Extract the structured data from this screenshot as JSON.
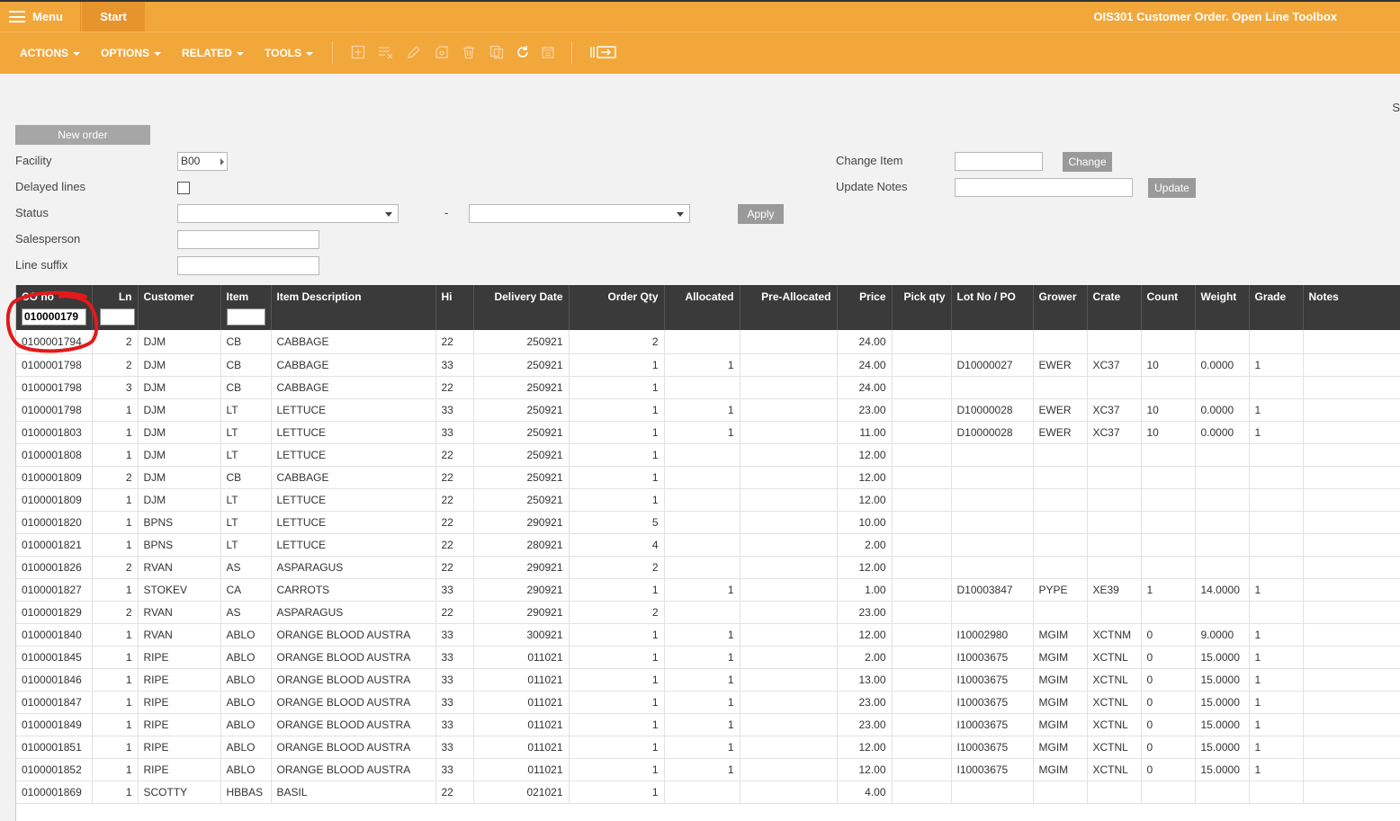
{
  "topbar": {
    "menu_label": "Menu",
    "start_tab": "Start",
    "title": "OIS301 Customer Order. Open Line Toolbox"
  },
  "toolbar": {
    "menus": [
      "ACTIONS",
      "OPTIONS",
      "RELATED",
      "TOOLS"
    ],
    "icons": [
      "add-icon",
      "copy-lines-icon",
      "edit-icon",
      "save-icon",
      "delete-icon",
      "duplicate-icon",
      "refresh-icon",
      "calendar-icon",
      "export-icon"
    ]
  },
  "form": {
    "new_order": "New order",
    "facility_label": "Facility",
    "facility_value": "B00",
    "delayed_label": "Delayed lines",
    "status_label": "Status",
    "status_dash": "-",
    "apply": "Apply",
    "salesperson_label": "Salesperson",
    "line_suffix_label": "Line suffix",
    "change_item_label": "Change Item",
    "change_btn": "Change",
    "update_notes_label": "Update Notes",
    "update_btn": "Update",
    "edge_text": "S"
  },
  "grid": {
    "columns": [
      "CO no",
      "Ln",
      "Customer",
      "Item",
      "Item Description",
      "Hi",
      "Delivery Date",
      "Order Qty",
      "Allocated",
      "Pre-Allocated",
      "Price",
      "Pick qty",
      "Lot No / PO",
      "Grower",
      "Crate",
      "Count",
      "Weight",
      "Grade",
      "Notes"
    ],
    "filter_co": "010000179",
    "rows": [
      [
        "0100001794",
        "2",
        "DJM",
        "CB",
        "CABBAGE",
        "22",
        "250921",
        "2",
        "",
        "",
        "24.00",
        "",
        "",
        "",
        "",
        "",
        "",
        "",
        ""
      ],
      [
        "0100001798",
        "2",
        "DJM",
        "CB",
        "CABBAGE",
        "33",
        "250921",
        "1",
        "1",
        "",
        "24.00",
        "",
        "D10000027",
        "EWER",
        "XC37",
        "10",
        "0.0000",
        "1",
        ""
      ],
      [
        "0100001798",
        "3",
        "DJM",
        "CB",
        "CABBAGE",
        "22",
        "250921",
        "1",
        "",
        "",
        "24.00",
        "",
        "",
        "",
        "",
        "",
        "",
        "",
        ""
      ],
      [
        "0100001798",
        "1",
        "DJM",
        "LT",
        "LETTUCE",
        "33",
        "250921",
        "1",
        "1",
        "",
        "23.00",
        "",
        "D10000028",
        "EWER",
        "XC37",
        "10",
        "0.0000",
        "1",
        ""
      ],
      [
        "0100001803",
        "1",
        "DJM",
        "LT",
        "LETTUCE",
        "33",
        "250921",
        "1",
        "1",
        "",
        "11.00",
        "",
        "D10000028",
        "EWER",
        "XC37",
        "10",
        "0.0000",
        "1",
        ""
      ],
      [
        "0100001808",
        "1",
        "DJM",
        "LT",
        "LETTUCE",
        "22",
        "250921",
        "1",
        "",
        "",
        "12.00",
        "",
        "",
        "",
        "",
        "",
        "",
        "",
        ""
      ],
      [
        "0100001809",
        "2",
        "DJM",
        "CB",
        "CABBAGE",
        "22",
        "250921",
        "1",
        "",
        "",
        "12.00",
        "",
        "",
        "",
        "",
        "",
        "",
        "",
        ""
      ],
      [
        "0100001809",
        "1",
        "DJM",
        "LT",
        "LETTUCE",
        "22",
        "250921",
        "1",
        "",
        "",
        "12.00",
        "",
        "",
        "",
        "",
        "",
        "",
        "",
        ""
      ],
      [
        "0100001820",
        "1",
        "BPNS",
        "LT",
        "LETTUCE",
        "22",
        "290921",
        "5",
        "",
        "",
        "10.00",
        "",
        "",
        "",
        "",
        "",
        "",
        "",
        ""
      ],
      [
        "0100001821",
        "1",
        "BPNS",
        "LT",
        "LETTUCE",
        "22",
        "280921",
        "4",
        "",
        "",
        "2.00",
        "",
        "",
        "",
        "",
        "",
        "",
        "",
        ""
      ],
      [
        "0100001826",
        "2",
        "RVAN",
        "AS",
        "ASPARAGUS",
        "22",
        "290921",
        "2",
        "",
        "",
        "12.00",
        "",
        "",
        "",
        "",
        "",
        "",
        "",
        ""
      ],
      [
        "0100001827",
        "1",
        "STOKEV",
        "CA",
        "CARROTS",
        "33",
        "290921",
        "1",
        "1",
        "",
        "1.00",
        "",
        "D10003847",
        "PYPE",
        "XE39",
        "1",
        "14.0000",
        "1",
        ""
      ],
      [
        "0100001829",
        "2",
        "RVAN",
        "AS",
        "ASPARAGUS",
        "22",
        "290921",
        "2",
        "",
        "",
        "23.00",
        "",
        "",
        "",
        "",
        "",
        "",
        "",
        ""
      ],
      [
        "0100001840",
        "1",
        "RVAN",
        "ABLO",
        "ORANGE BLOOD AUSTRA",
        "33",
        "300921",
        "1",
        "1",
        "",
        "12.00",
        "",
        "I10002980",
        "MGIM",
        "XCTNM",
        "0",
        "9.0000",
        "1",
        ""
      ],
      [
        "0100001845",
        "1",
        "RIPE",
        "ABLO",
        "ORANGE BLOOD AUSTRA",
        "33",
        "011021",
        "1",
        "1",
        "",
        "2.00",
        "",
        "I10003675",
        "MGIM",
        "XCTNL",
        "0",
        "15.0000",
        "1",
        ""
      ],
      [
        "0100001846",
        "1",
        "RIPE",
        "ABLO",
        "ORANGE BLOOD AUSTRA",
        "33",
        "011021",
        "1",
        "1",
        "",
        "13.00",
        "",
        "I10003675",
        "MGIM",
        "XCTNL",
        "0",
        "15.0000",
        "1",
        ""
      ],
      [
        "0100001847",
        "1",
        "RIPE",
        "ABLO",
        "ORANGE BLOOD AUSTRA",
        "33",
        "011021",
        "1",
        "1",
        "",
        "23.00",
        "",
        "I10003675",
        "MGIM",
        "XCTNL",
        "0",
        "15.0000",
        "1",
        ""
      ],
      [
        "0100001849",
        "1",
        "RIPE",
        "ABLO",
        "ORANGE BLOOD AUSTRA",
        "33",
        "011021",
        "1",
        "1",
        "",
        "23.00",
        "",
        "I10003675",
        "MGIM",
        "XCTNL",
        "0",
        "15.0000",
        "1",
        ""
      ],
      [
        "0100001851",
        "1",
        "RIPE",
        "ABLO",
        "ORANGE BLOOD AUSTRA",
        "33",
        "011021",
        "1",
        "1",
        "",
        "12.00",
        "",
        "I10003675",
        "MGIM",
        "XCTNL",
        "0",
        "15.0000",
        "1",
        ""
      ],
      [
        "0100001852",
        "1",
        "RIPE",
        "ABLO",
        "ORANGE BLOOD AUSTRA",
        "33",
        "011021",
        "1",
        "1",
        "",
        "12.00",
        "",
        "I10003675",
        "MGIM",
        "XCTNL",
        "0",
        "15.0000",
        "1",
        ""
      ],
      [
        "0100001869",
        "1",
        "SCOTTY",
        "HBBAS",
        "BASIL",
        "22",
        "021021",
        "1",
        "",
        "",
        "4.00",
        "",
        "",
        "",
        "",
        "",
        "",
        "",
        ""
      ]
    ]
  }
}
